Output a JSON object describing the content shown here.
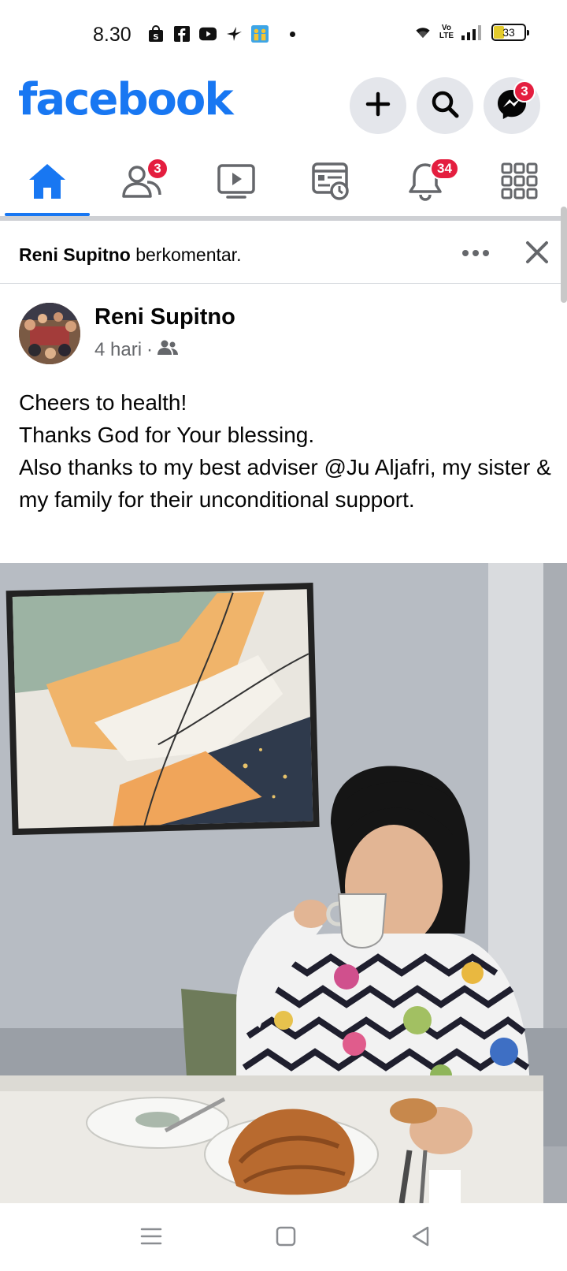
{
  "status_bar": {
    "time": "8.30",
    "battery_level": "33",
    "network_label_top": "Vo",
    "network_label_bottom": "LTE"
  },
  "header": {
    "logo": "facebook",
    "brand_color": "#1877f2",
    "messenger_badge": "3",
    "icons": [
      "plus-icon",
      "search-icon",
      "messenger-icon"
    ]
  },
  "tabs": [
    {
      "name": "home",
      "active": true
    },
    {
      "name": "friends",
      "badge": "3"
    },
    {
      "name": "watch"
    },
    {
      "name": "news"
    },
    {
      "name": "notifications",
      "badge": "34"
    },
    {
      "name": "menu"
    }
  ],
  "notice": {
    "actor": "Reni Supitno",
    "action": "berkomentar."
  },
  "post": {
    "author": "Reni Supitno",
    "time": "4 hari",
    "separator": "·",
    "lines": [
      "Cheers to health!",
      "Thanks God for Your blessing.",
      "Also thanks to my best adviser @Ju Aljafri, my sister & my family for their unconditional support."
    ]
  }
}
